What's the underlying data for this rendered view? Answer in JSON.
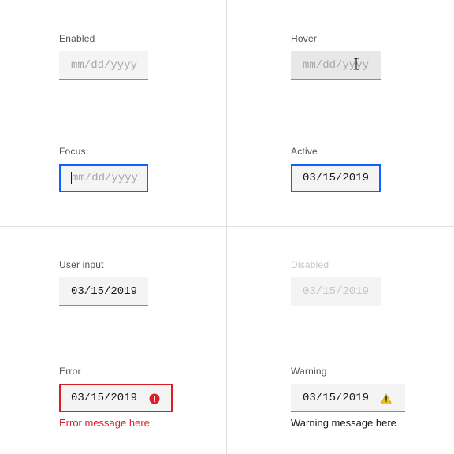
{
  "states": {
    "enabled": {
      "label": "Enabled",
      "placeholder": "mm/dd/yyyy"
    },
    "hover": {
      "label": "Hover",
      "placeholder": "mm/dd/yyyy"
    },
    "focus": {
      "label": "Focus",
      "placeholder": "mm/dd/yyyy"
    },
    "active": {
      "label": "Active",
      "value": "03/15/2019"
    },
    "user_input": {
      "label": "User input",
      "value": "03/15/2019"
    },
    "disabled": {
      "label": "Disabled",
      "value": "03/15/2019"
    },
    "error": {
      "label": "Error",
      "value": "03/15/2019",
      "message": "Error message here",
      "icon": "error-filled-icon"
    },
    "warning": {
      "label": "Warning",
      "value": "03/15/2019",
      "message": "Warning message here",
      "icon": "warning-alt-icon"
    }
  },
  "colors": {
    "focus": "#0f62fe",
    "error": "#da1e28",
    "warning": "#f1c21b",
    "field_bg": "#f4f4f4",
    "divider": "#e0e0e0"
  }
}
